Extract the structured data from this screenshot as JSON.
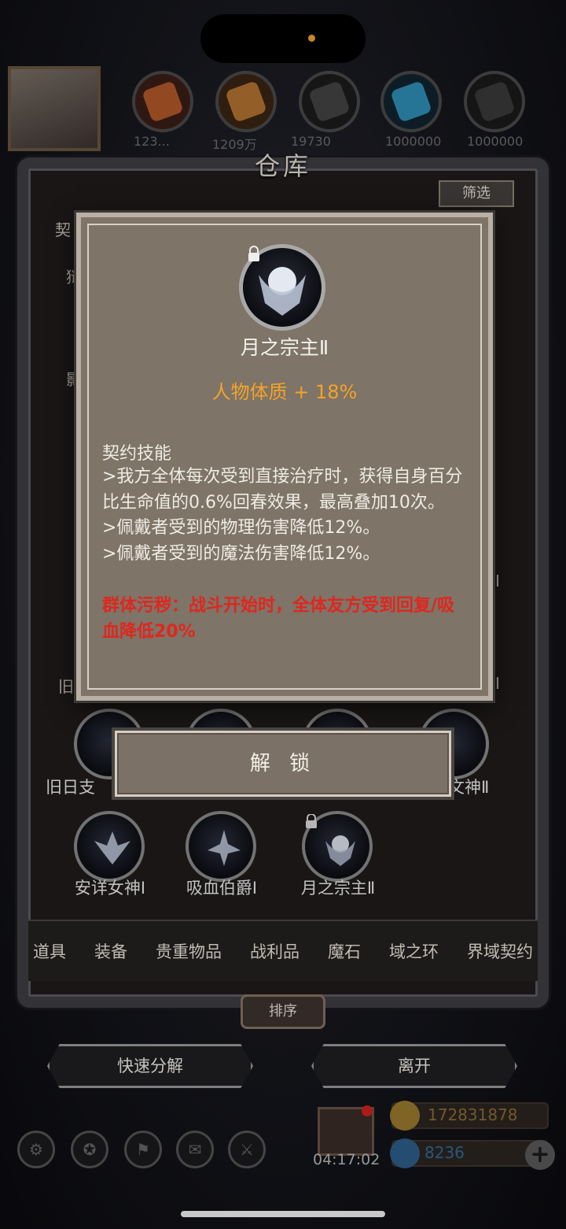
{
  "status": {
    "notification_dot_color": "#f2a531"
  },
  "resources": [
    {
      "icon": "meat-icon",
      "value": "123...",
      "color": "#b25a2a"
    },
    {
      "icon": "wood-icon",
      "value": "1209万",
      "color": "#b57333"
    },
    {
      "icon": "iron-icon",
      "value": "19730",
      "color": "#444"
    },
    {
      "icon": "crystal-icon",
      "value": "1000000",
      "color": "#2f8fb8"
    },
    {
      "icon": "ore-icon",
      "value": "1000000",
      "color": "#3a3a3a"
    }
  ],
  "warehouse": {
    "title": "仓库",
    "filter_label": "筛选",
    "behind_fragments": [
      "契",
      "狱",
      "影",
      "旧",
      "Ⅰ",
      "Ⅰ",
      "Ⅰ"
    ],
    "row1_labels": [
      "旧日支",
      "文神Ⅱ"
    ],
    "row2": [
      {
        "name": "安详女神Ⅰ",
        "locked": false
      },
      {
        "name": "吸血伯爵Ⅰ",
        "locked": false
      },
      {
        "name": "月之宗主Ⅱ",
        "locked": true
      }
    ],
    "tabs": [
      "道具",
      "装备",
      "贵重物品",
      "战利品",
      "魔石",
      "域之环",
      "界域契约"
    ],
    "sort_label": "排序",
    "quick_decompose_label": "快速分解",
    "leave_label": "离开"
  },
  "footer": {
    "timer": "04:17:02",
    "gold": "172831878",
    "gems": "8236",
    "plus_label": "+"
  },
  "tooltip": {
    "name": "月之宗主Ⅱ",
    "attribute": "人物体质 + 18%",
    "skill_title": "契约技能",
    "skill_line1": ">我方全体每次受到直接治疗时，获得自身百分比生命值的0.6%回春效果，最高叠加10次。",
    "skill_line2": ">佩戴者受到的物理伤害降低12%。",
    "skill_line3": ">佩戴者受到的魔法伤害降低12%。",
    "curse": "群体污秽：战斗开始时，全体友方受到回复/吸血降低20%",
    "unlock_label": "解 锁"
  }
}
